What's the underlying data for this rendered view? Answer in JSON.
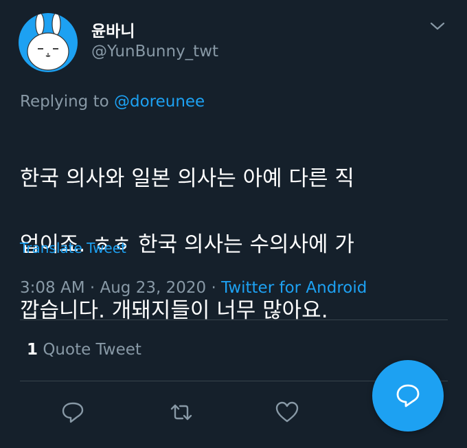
{
  "tweet": {
    "display_name": "윤바니",
    "handle": "@YunBunny_twt",
    "replying_prefix": "Replying to",
    "replying_to": "@doreunee",
    "text_lines": [
      "한국 의사와 일본 의사는 아예 다른 직",
      "업이죠. ㅎㅎ 한국 의사는 수의사에 가",
      "깝습니다. 개돼지들이 너무 많아요."
    ],
    "translate_label": "Translate Tweet",
    "time": "3:08 AM",
    "date": "Aug 23, 2020",
    "separator": "·",
    "source": "Twitter for Android",
    "quote_count": "1",
    "quote_label": "Quote Tweet"
  },
  "icons": {
    "menu": "chevron-down-icon",
    "reply": "reply-icon",
    "retweet": "retweet-icon",
    "like": "heart-icon",
    "compose": "compose-reply-icon"
  },
  "colors": {
    "background": "#15202b",
    "text": "#ffffff",
    "muted": "#8899a6",
    "accent": "#1da1f2",
    "divider": "#38444d"
  }
}
